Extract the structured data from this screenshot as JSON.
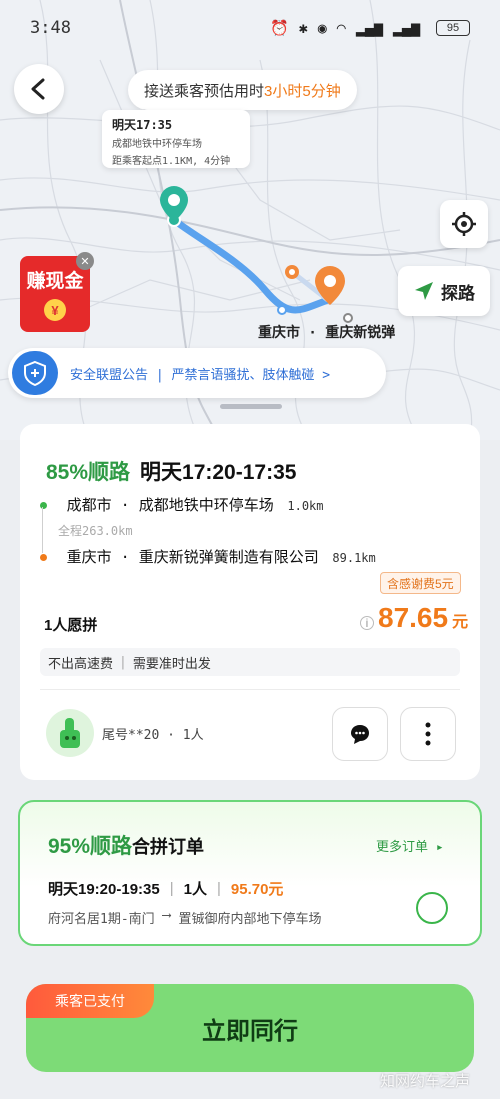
{
  "status": {
    "time": "3:48",
    "battery": "95"
  },
  "map": {
    "eta_prefix": "接送乘客预估用时",
    "eta_value": "3小时5分钟",
    "pickup": {
      "line1": "明天17:35",
      "line2": "成都地铁中环停车场",
      "line3": "距乘客起点1.1KM, 4分钟"
    },
    "explore_label": "探路",
    "cash_label": "赚现金",
    "coin_symbol": "¥",
    "destination_label": "重庆市 · 重庆新锐弹",
    "safety_notice": "安全联盟公告 | 严禁言语骚扰、肢体触碰 >"
  },
  "trip": {
    "match_pct": "85%顺路",
    "time_range": "明天17:20-17:35",
    "origin": "成都市 · 成都地铁中环停车场",
    "origin_dist": "1.0km",
    "total": "全程263.0km",
    "destination": "重庆市 · 重庆新锐弹簧制造有限公司",
    "destination_dist": "89.1km",
    "thanks_tag": "含感谢费5元",
    "pool_label": "1人愿拼",
    "price": "87.65",
    "price_unit": "元",
    "notes": [
      "不出高速费",
      "需要准时出发"
    ],
    "passenger": "尾号**20 · 1人"
  },
  "pool_order": {
    "match_pct": "95%顺路",
    "title_suffix": "合拼订单",
    "more_label": "更多订单 ▸",
    "time": "明天19:20-19:35",
    "count": "1人",
    "amount": "95.70元",
    "from": "府河名居1期-南门",
    "arrow": "⟶",
    "to": "置铖御府内部地下停车场"
  },
  "action": {
    "paid_tag": "乘客已支付",
    "go_label": "立即同行"
  },
  "watermark": "知网约车之声",
  "colors": {
    "green": "#2e9a44",
    "orange": "#f07a1a",
    "blue": "#2f7ce0"
  }
}
